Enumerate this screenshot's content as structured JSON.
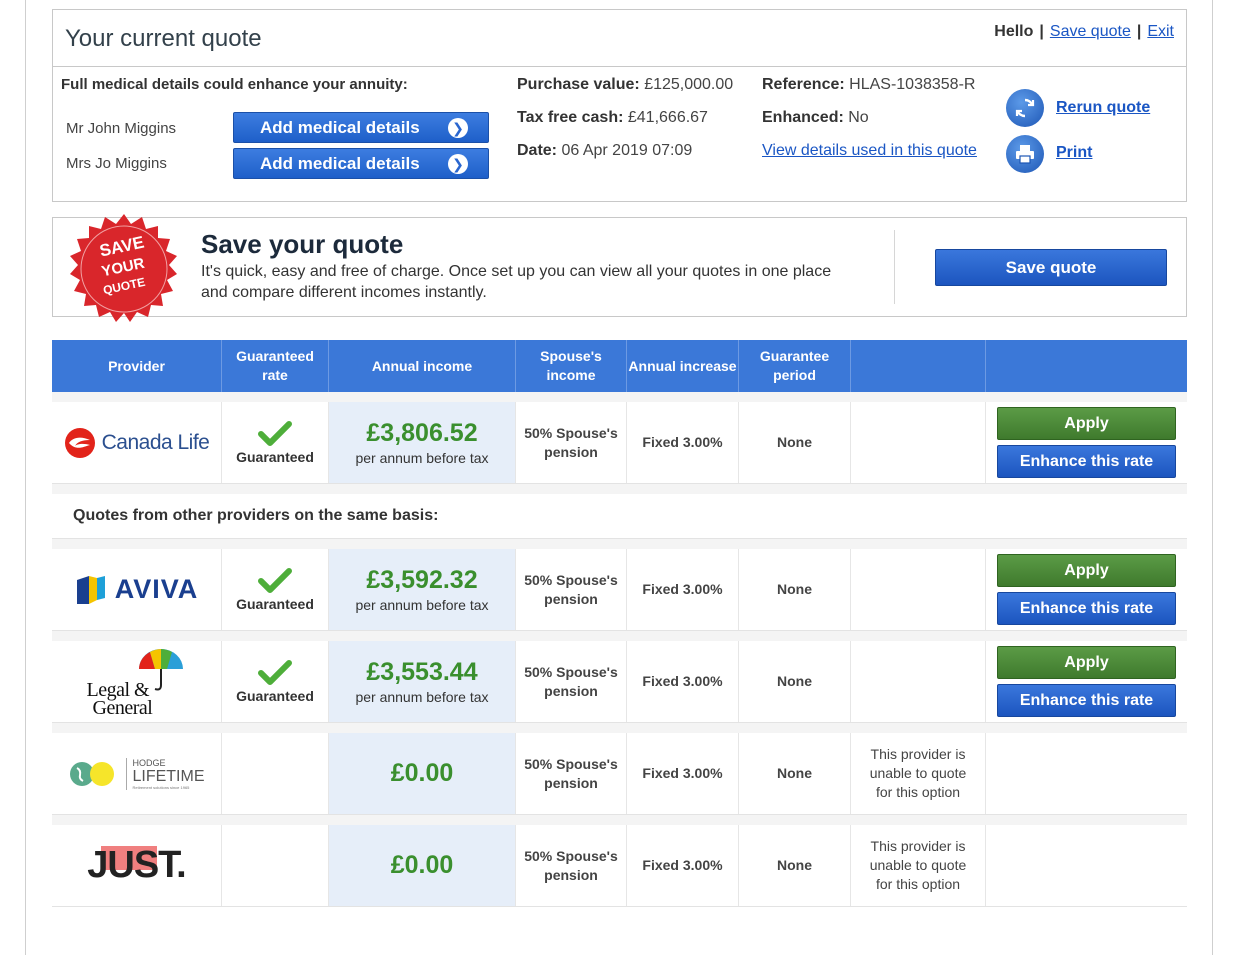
{
  "header": {
    "title": "Your current quote",
    "hello": "Hello",
    "save_quote_link": "Save quote",
    "exit_link": "Exit"
  },
  "medical": {
    "heading": "Full medical details could enhance your annuity:",
    "persons": [
      {
        "name": "Mr John Miggins",
        "button": "Add medical details"
      },
      {
        "name": "Mrs Jo Miggins",
        "button": "Add medical details"
      }
    ]
  },
  "details": {
    "purchase_label": "Purchase value:",
    "purchase_value": "£125,000.00",
    "taxfree_label": "Tax free cash:",
    "taxfree_value": "£41,666.67",
    "date_label": "Date:",
    "date_value": "06 Apr 2019 07:09",
    "reference_label": "Reference:",
    "reference_value": "HLAS-1038358-R",
    "enhanced_label": "Enhanced:",
    "enhanced_value": "No",
    "view_details_link": "View details used in this quote"
  },
  "actions": {
    "rerun": "Rerun quote",
    "print": "Print"
  },
  "save_panel": {
    "seal_line1": "SAVE",
    "seal_line2": "YOUR",
    "seal_line3": "QUOTE",
    "title": "Save your quote",
    "description": "It's quick, easy and free of charge. Once set up you can view all your quotes in one place and compare different incomes instantly.",
    "button": "Save quote"
  },
  "table": {
    "headers": [
      "Provider",
      "Guaranteed rate",
      "Annual income",
      "Spouse's income",
      "Annual increase",
      "Guarantee period",
      "",
      ""
    ],
    "other_heading": "Quotes from other providers on the same basis:",
    "rows": [
      {
        "provider": "Canada Life",
        "guaranteed": "Guaranteed",
        "amount": "£3,806.52",
        "per_annum": "per annum before tax",
        "spouse": "50% Spouse's pension",
        "increase": "Fixed 3.00%",
        "period": "None",
        "apply": "Apply",
        "enhance": "Enhance this rate"
      },
      {
        "provider": "AVIVA",
        "guaranteed": "Guaranteed",
        "amount": "£3,592.32",
        "per_annum": "per annum before tax",
        "spouse": "50% Spouse's pension",
        "increase": "Fixed 3.00%",
        "period": "None",
        "apply": "Apply",
        "enhance": "Enhance this rate"
      },
      {
        "provider_line1": "Legal &",
        "provider_line2": "General",
        "guaranteed": "Guaranteed",
        "amount": "£3,553.44",
        "per_annum": "per annum before tax",
        "spouse": "50% Spouse's pension",
        "increase": "Fixed 3.00%",
        "period": "None",
        "apply": "Apply",
        "enhance": "Enhance this rate"
      },
      {
        "provider_line1": "HODGE",
        "provider_line2": "LIFETIME",
        "provider_line3": "Retirement solutions since 1965",
        "amount": "£0.00",
        "spouse": "50% Spouse's pension",
        "increase": "Fixed 3.00%",
        "period": "None",
        "note": "This provider is unable to quote for this option"
      },
      {
        "provider": "JUST.",
        "amount": "£0.00",
        "spouse": "50% Spouse's pension",
        "increase": "Fixed 3.00%",
        "period": "None",
        "note": "This provider is unable to quote for this option"
      }
    ]
  },
  "colors": {
    "primary_blue": "#3b78d8",
    "apply_green": "#4a8a37",
    "amount_green": "#3a8f2e",
    "income_bg": "#e6eef9",
    "seal_red": "#d9262b"
  }
}
